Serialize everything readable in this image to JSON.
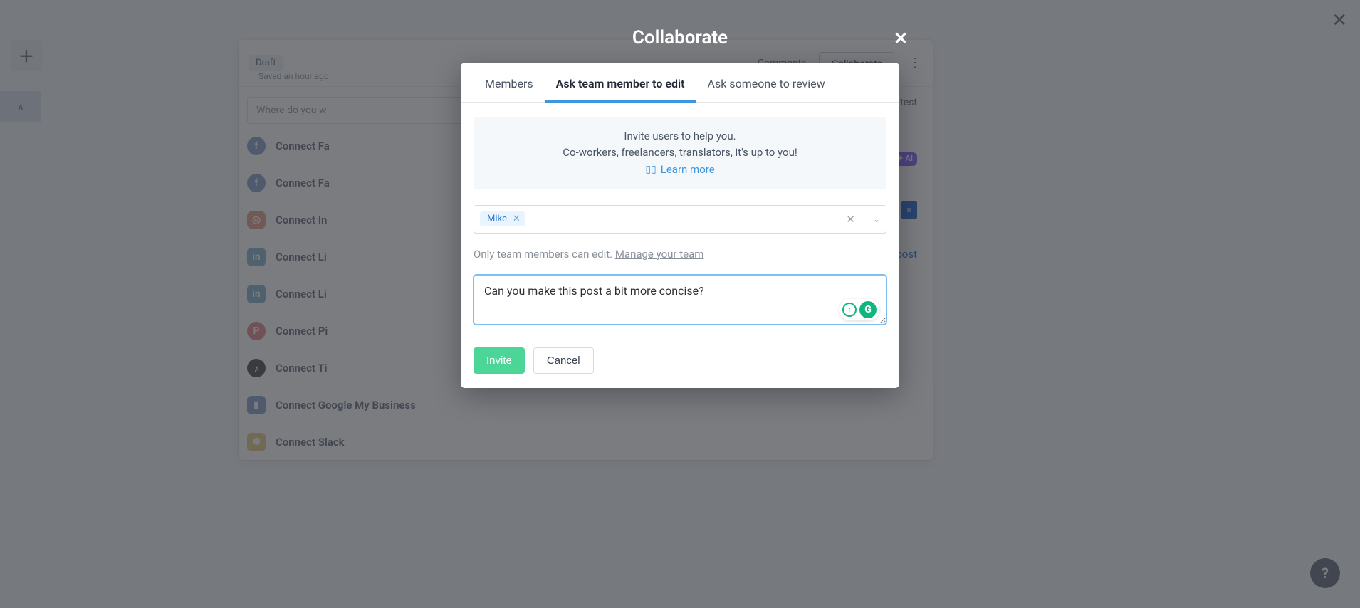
{
  "page": {
    "close_glyph": "✕"
  },
  "bg": {
    "plus_glyph": "＋",
    "left_tab_glyph": "∧",
    "draft_pill": "Draft",
    "saved_text": "Saved an hour ago",
    "comments_label": "Comments",
    "collaborate_label": "Collaborate",
    "kebab_glyph": "⋮",
    "where_placeholder": "Where do you w",
    "channels": [
      {
        "label": "Connect Fa",
        "icon_class": "ic-fb",
        "glyph": "f"
      },
      {
        "label": "Connect Fa",
        "icon_class": "ic-fb",
        "glyph": "f"
      },
      {
        "label": "Connect In",
        "icon_class": "ic-ig",
        "glyph": "◎"
      },
      {
        "label": "Connect Li",
        "icon_class": "ic-li",
        "glyph": "in"
      },
      {
        "label": "Connect Li",
        "icon_class": "ic-li",
        "glyph": "in"
      },
      {
        "label": "Connect Pi",
        "icon_class": "ic-pin",
        "glyph": "P"
      },
      {
        "label": "Connect Ti",
        "icon_class": "ic-tt",
        "glyph": "♪"
      },
      {
        "label": "Connect Google My Business",
        "icon_class": "ic-gmb",
        "glyph": "▮"
      },
      {
        "label": "Connect Slack",
        "icon_class": "ic-sl",
        "glyph": "✱"
      }
    ],
    "right": {
      "line1": "online test",
      "ai_label": "✦ AI",
      "post_label": "post"
    },
    "scroll_glyph": "▾",
    "help_glyph": "?"
  },
  "overlay": {
    "title": "Collaborate",
    "close_glyph": "✕"
  },
  "modal": {
    "tabs": {
      "members": "Members",
      "ask_edit": "Ask team member to edit",
      "ask_review": "Ask someone to review"
    },
    "info": {
      "line1": "Invite users to help you.",
      "line2": "Co-workers, freelancers, translators, it's up to you!",
      "learn_more": "Learn more",
      "book_glyph": "▯▯"
    },
    "select": {
      "chips": [
        {
          "label": "Mike"
        }
      ],
      "chip_remove_glyph": "✕",
      "clear_glyph": "✕",
      "caret_glyph": "⌄"
    },
    "helper": {
      "text": "Only team members can edit. ",
      "link": "Manage your team"
    },
    "message_value": "Can you make this post a bit more concise?",
    "grammarly_g": "G",
    "actions": {
      "invite": "Invite",
      "cancel": "Cancel"
    }
  }
}
